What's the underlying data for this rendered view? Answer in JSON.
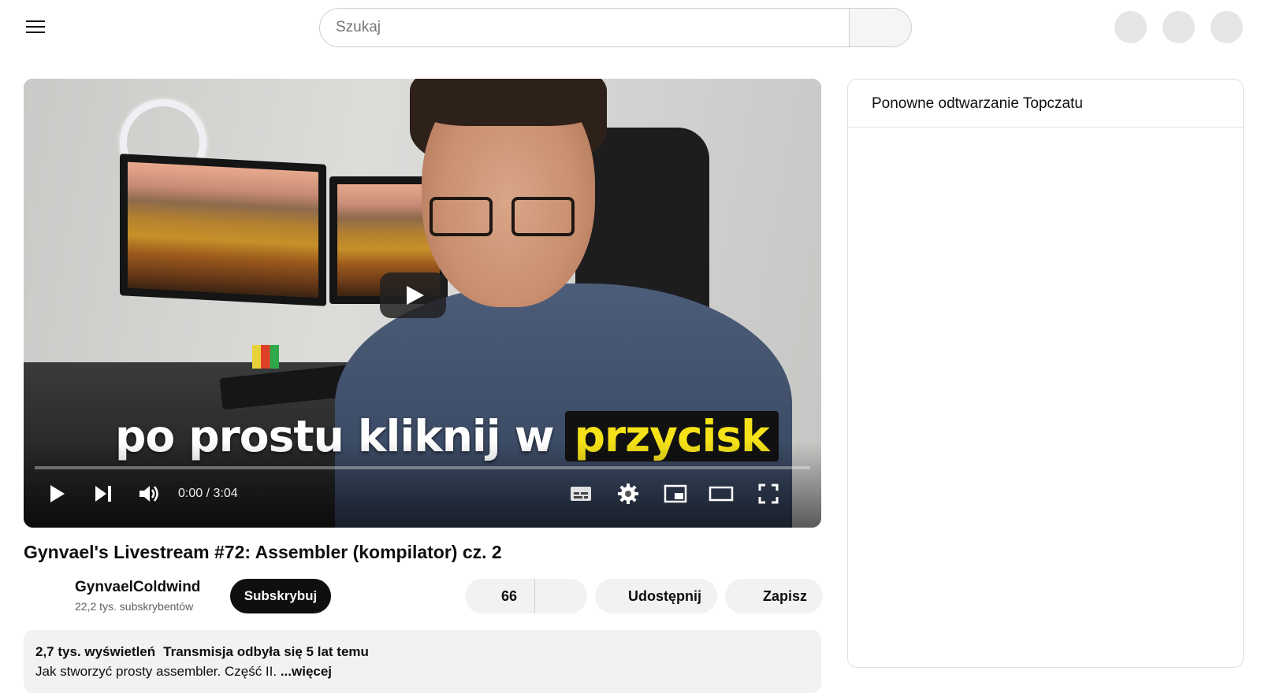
{
  "header": {
    "menu_icon": "hamburger-menu-icon",
    "search_placeholder": "Szukaj",
    "search_icon": "search-icon"
  },
  "player": {
    "caption_white": "po prostu kliknij w",
    "caption_yellow": "przycisk",
    "time": "0:00 / 3:04",
    "progress": 0,
    "icons": [
      "play-icon",
      "next-icon",
      "volume-icon",
      "subtitles-icon",
      "settings-gear-icon",
      "miniplayer-icon",
      "theater-mode-icon",
      "fullscreen-icon"
    ]
  },
  "video": {
    "title": "Gynvael's Livestream #72: Assembler (kompilator) cz. 2",
    "channel_name": "GynvaelColdwind",
    "subscribers": "22,2 tys. subskrybentów",
    "subscribe_label": "Subskrybuj",
    "likes": "66",
    "share_label": "Udostępnij",
    "save_label": "Zapisz"
  },
  "description": {
    "views": "2,7 tys. wyświetleń",
    "streamed": "Transmisja odbyła się 5 lat temu",
    "text": "Jak stworzyć prosty assembler. Część II.",
    "more_label": "...więcej"
  },
  "chat": {
    "title": "Ponowne odtwarzanie Topczatu"
  },
  "colors": {
    "accent_caption": "#f5e219",
    "subscribe_bg": "#0f0f0f",
    "pill_bg": "#f2f2f2"
  }
}
